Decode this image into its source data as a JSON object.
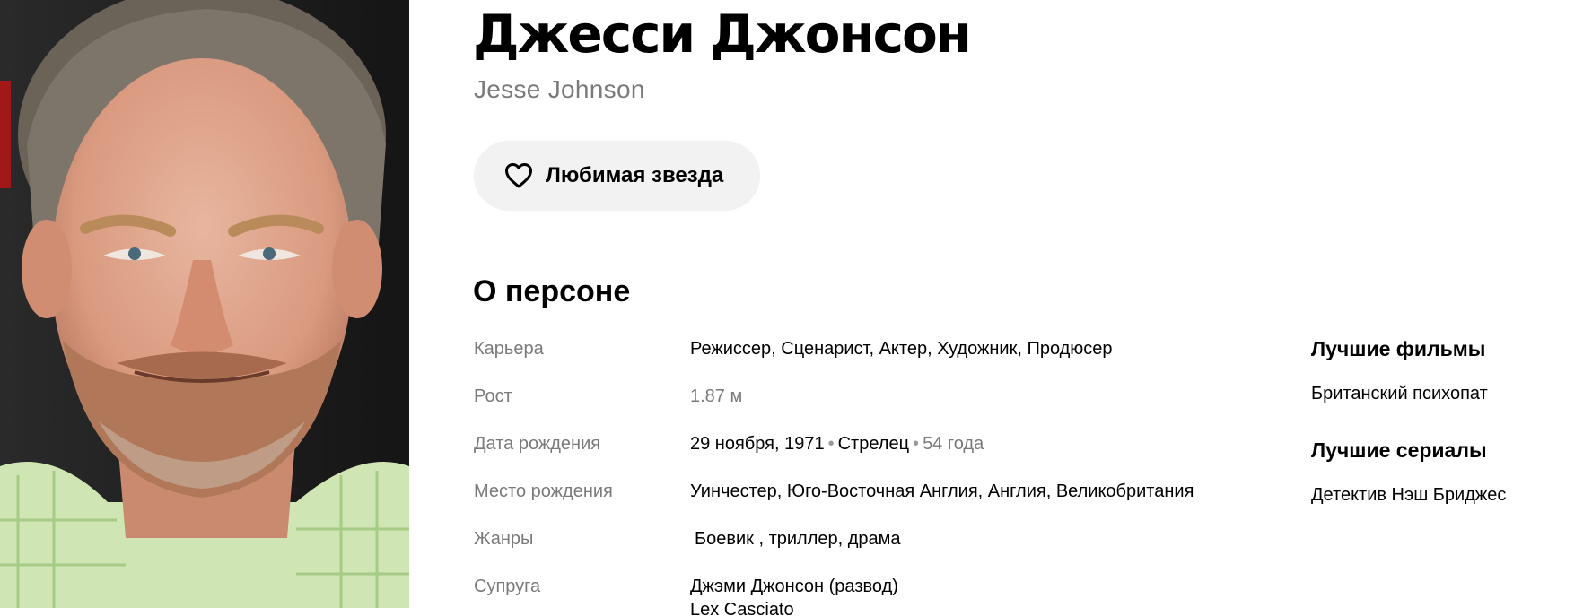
{
  "person": {
    "name": "Джесси Джонсон",
    "original_name": "Jesse Johnson"
  },
  "favorite_button": {
    "label": "Любимая звезда",
    "icon": "heart-outline-icon"
  },
  "about": {
    "title": "О персоне",
    "rows": [
      {
        "key": "Карьера",
        "value": "Режиссер, Сценарист, Актер, Художник, Продюсер"
      },
      {
        "key": "Рост",
        "value": "1.87 м"
      },
      {
        "key": "Дата рождения",
        "date": "29 ноября, 1971",
        "zodiac": "Стрелец",
        "age": "54 года"
      },
      {
        "key": "Место рождения",
        "value": "Уинчестер, Юго-Восточная Англия, Англия, Великобритания"
      },
      {
        "key": "Жанры",
        "value": "Боевик , триллер, драма"
      },
      {
        "key": "Супруга",
        "lines": [
          "Джэми Джонсон (развод)",
          "Lex Casciato"
        ]
      }
    ]
  },
  "sidebar": {
    "best_films": {
      "title": "Лучшие фильмы",
      "items": [
        "Британский психопат"
      ]
    },
    "best_series": {
      "title": "Лучшие сериалы",
      "items": [
        "Детектив Нэш Бриджес"
      ]
    }
  },
  "colors": {
    "muted_text": "#7a7a7a",
    "button_bg": "#f2f2f2",
    "text": "#000000"
  }
}
